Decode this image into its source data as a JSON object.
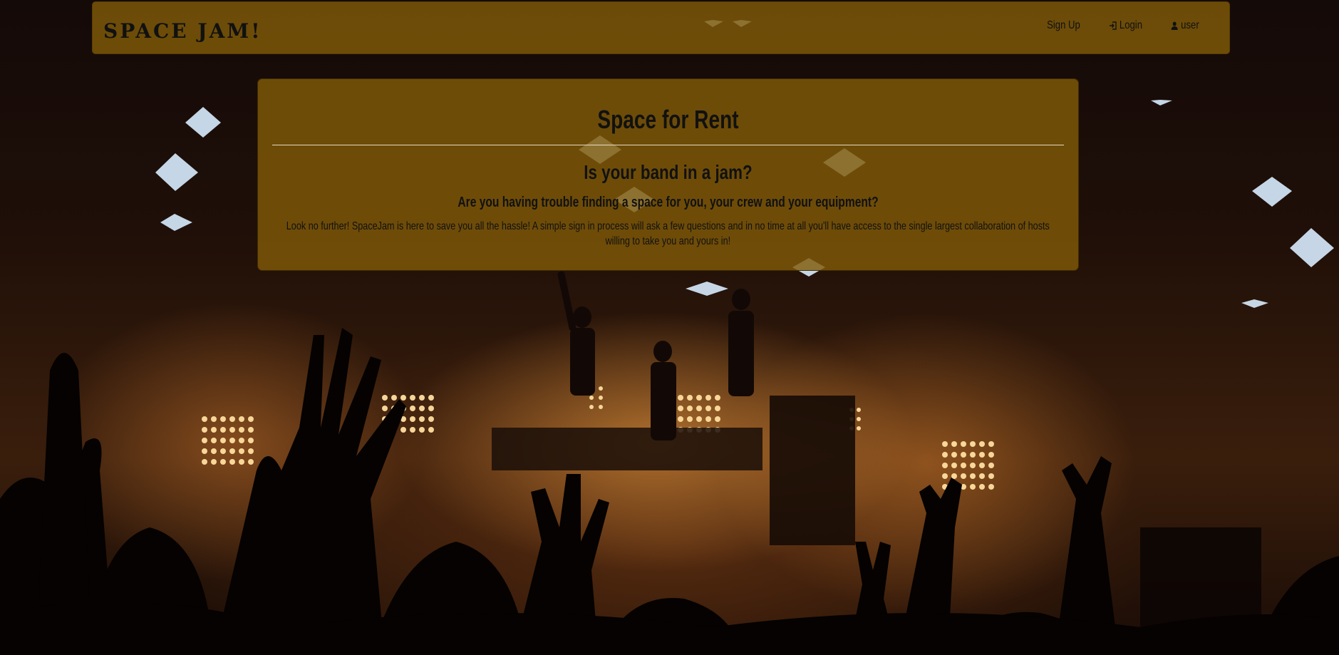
{
  "background": {
    "description_icon": "concert-crowd-photo"
  },
  "navbar": {
    "brand": "SPACE JAM!",
    "links": [
      {
        "label": "Sign Up",
        "icon": ""
      },
      {
        "label": "Login",
        "icon": "login-icon"
      },
      {
        "label": "user",
        "icon": "user-icon"
      }
    ]
  },
  "hero": {
    "title": "Space for Rent",
    "heading": "Is your band in a jam?",
    "subheading": "Are you having trouble finding a space for you, your crew and your equipment?",
    "body": "Look no further! SpaceJam is here to save you all the hassle! A simple sign in process will ask a few questions and in no time at all you'll have access to the single largest collaboration of hosts willing to take you and yours in!"
  },
  "colors": {
    "panel_bg": "#805a08",
    "text": "#111111",
    "rule": "#e8dcc0"
  }
}
